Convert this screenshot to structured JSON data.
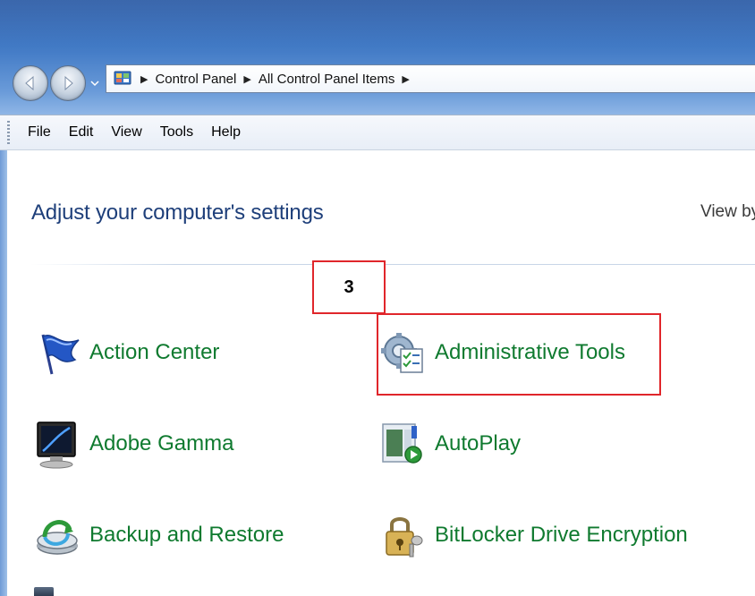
{
  "window": {
    "address_bar": {
      "breadcrumbs": [
        "Control Panel",
        "All Control Panel Items"
      ]
    },
    "menu": [
      "File",
      "Edit",
      "View",
      "Tools",
      "Help"
    ]
  },
  "content": {
    "heading": "Adjust your computer's settings",
    "view_by_label": "View by",
    "items": [
      {
        "label": "Action Center",
        "icon": "flag-icon"
      },
      {
        "label": "Administrative Tools",
        "icon": "admin-tools-icon"
      },
      {
        "label": "Adobe Gamma",
        "icon": "monitor-icon"
      },
      {
        "label": "AutoPlay",
        "icon": "autoplay-icon"
      },
      {
        "label": "Backup and Restore",
        "icon": "backup-icon"
      },
      {
        "label": "BitLocker Drive Encryption",
        "icon": "padlock-key-icon"
      }
    ]
  },
  "annotation": {
    "step_number": "3",
    "color": "#e0262b"
  },
  "colors": {
    "link_green": "#0f7a2f",
    "heading_blue": "#1e3f7a",
    "title_bar_blue": "#3f78c4"
  }
}
